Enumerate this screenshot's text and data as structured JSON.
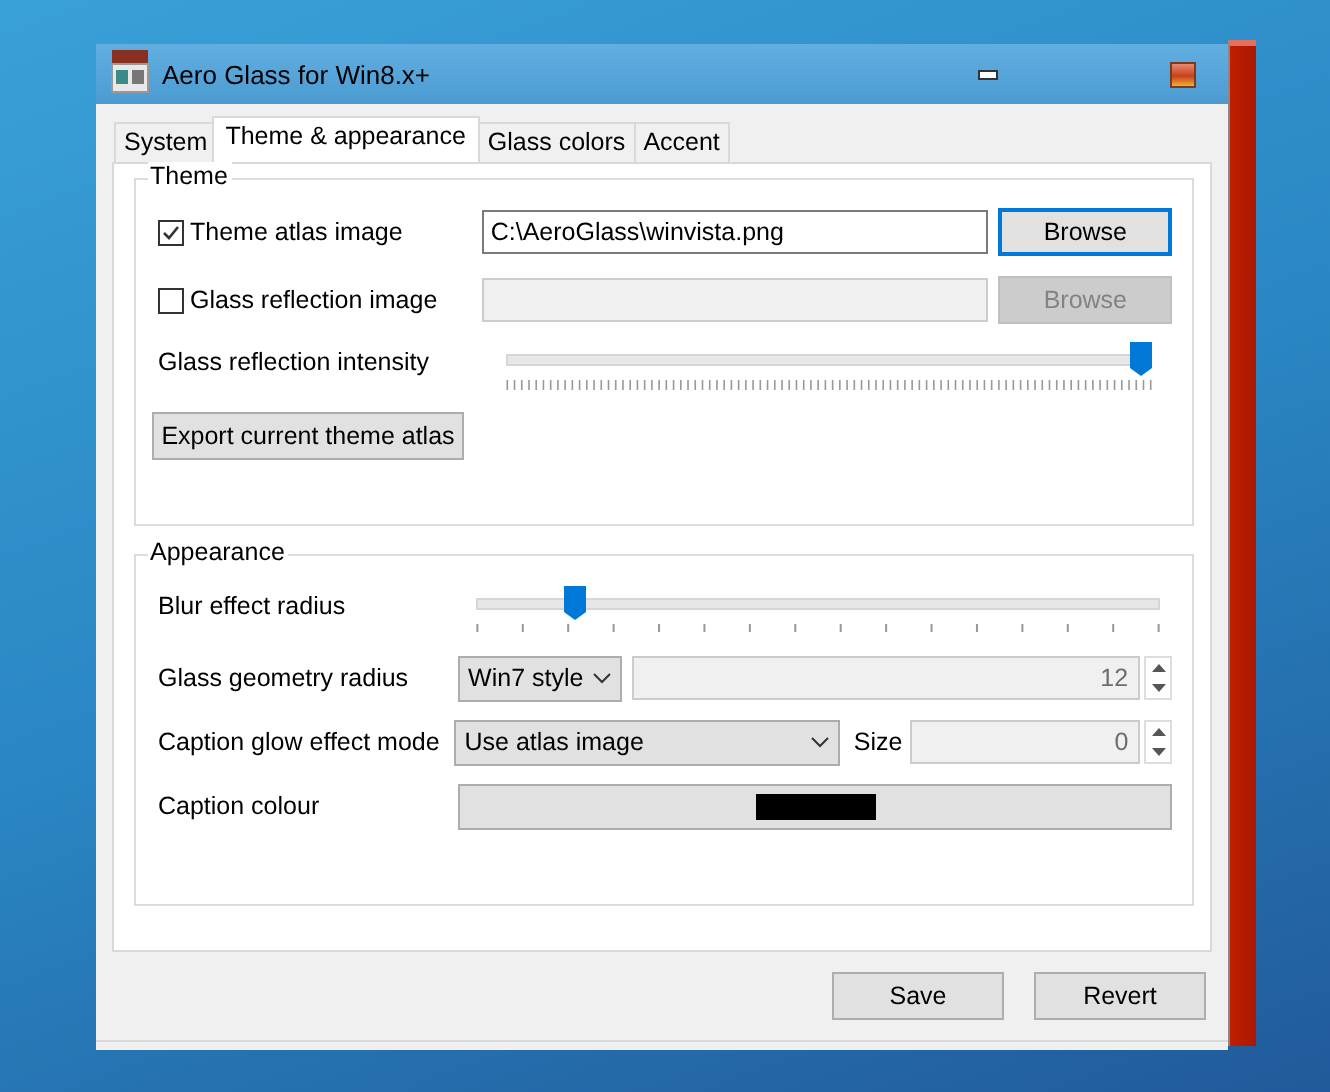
{
  "window": {
    "title": "Aero Glass for Win8.x+"
  },
  "tabs": [
    {
      "label": "System",
      "selected": false
    },
    {
      "label": "Theme & appearance",
      "selected": true
    },
    {
      "label": "Glass colors",
      "selected": false
    },
    {
      "label": "Accent",
      "selected": false
    }
  ],
  "theme_group": {
    "title": "Theme",
    "atlas": {
      "label": "Theme atlas image",
      "checked": true,
      "value": "C:\\AeroGlass\\winvista.png",
      "button": "Browse",
      "disabled": false
    },
    "reflection": {
      "label": "Glass reflection image",
      "checked": false,
      "button": "Browse",
      "disabled": true
    },
    "intensity": {
      "label": "Glass reflection intensity",
      "level": 1.0
    },
    "export_button": "Export current theme atlas"
  },
  "appearance_group": {
    "title": "Appearance",
    "blur": {
      "label": "Blur effect radius",
      "level": 0.133
    },
    "geometry": {
      "label": "Glass geometry radius",
      "dropdown": "Win7 style",
      "value": "12"
    },
    "glow": {
      "label": "Caption glow effect mode",
      "dropdown": "Use atlas image",
      "size_label": "Size",
      "size_value": "0"
    },
    "caption_colour": {
      "label": "Caption colour",
      "color": "#000000"
    }
  },
  "buttons": [
    "Save",
    "Revert"
  ]
}
